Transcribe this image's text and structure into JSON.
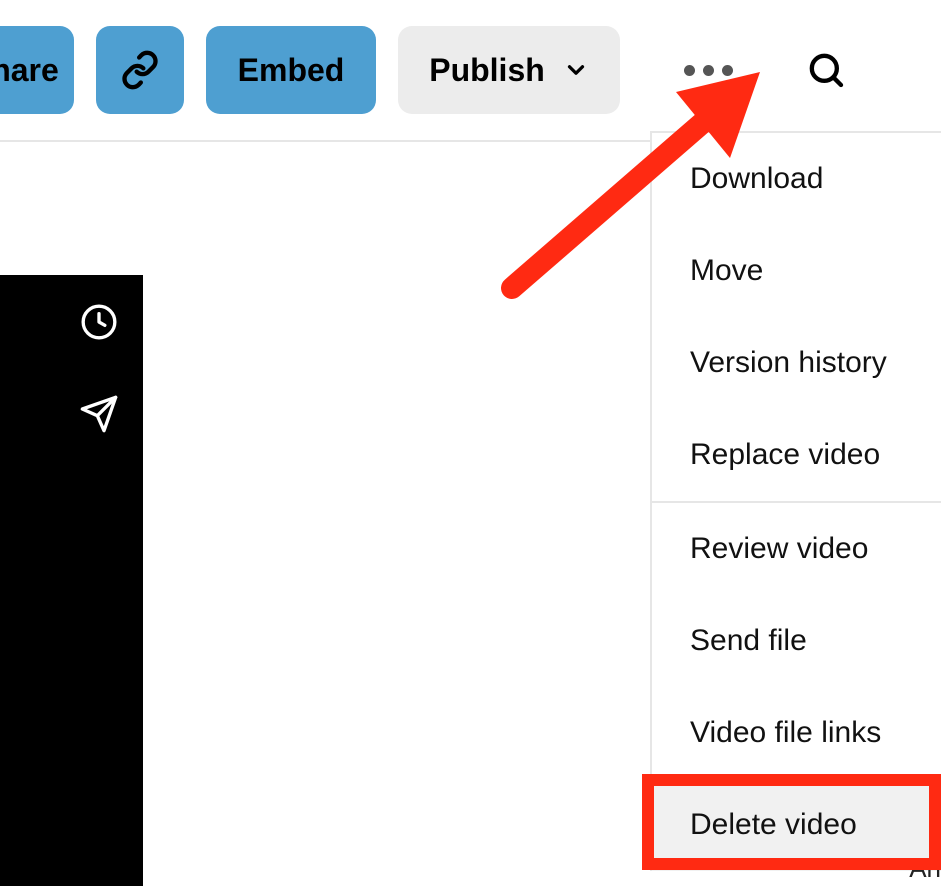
{
  "toolbar": {
    "share_label": "hare",
    "embed_label": "Embed",
    "publish_label": "Publish"
  },
  "menu": {
    "section1": [
      "Download",
      "Move",
      "Version history",
      "Replace video"
    ],
    "section2": [
      "Review video",
      "Send file",
      "Video file links",
      "Delete video"
    ]
  },
  "partial_text": "An"
}
